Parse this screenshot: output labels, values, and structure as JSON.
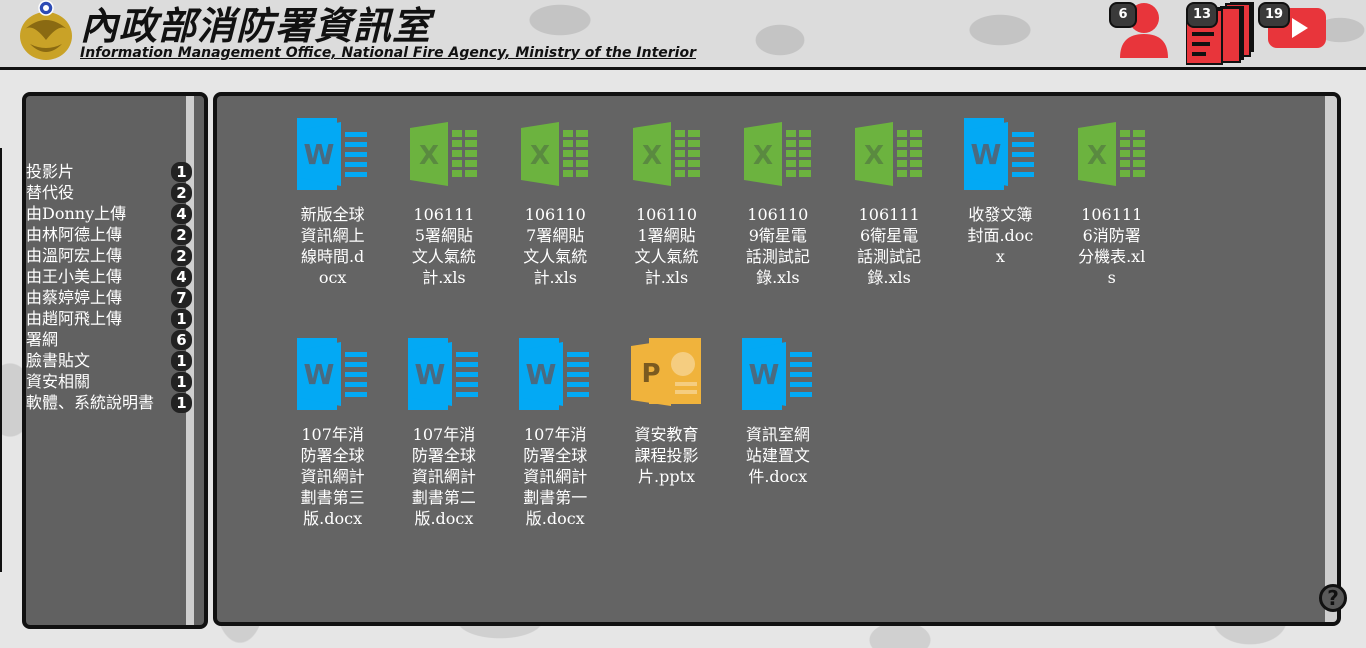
{
  "header": {
    "title_cn": "內政部消防署資訊室",
    "title_en": "Information Management Office, National Fire Agency, Ministry of the Interior",
    "users_count": "6",
    "documents_count": "13",
    "videos_count": "19",
    "icons": {
      "users": "person-icon",
      "documents": "document-stack-icon",
      "videos": "youtube-play-icon",
      "logo": "agency-emblem-logo"
    }
  },
  "sidebar": {
    "categories": [
      {
        "label": "投影片",
        "count": "1"
      },
      {
        "label": "替代役",
        "count": "2"
      },
      {
        "label": "由Donny上傳",
        "count": "4"
      },
      {
        "label": "由林阿德上傳",
        "count": "2"
      },
      {
        "label": "由溫阿宏上傳",
        "count": "2"
      },
      {
        "label": "由王小美上傳",
        "count": "4"
      },
      {
        "label": "由蔡婷婷上傳",
        "count": "7"
      },
      {
        "label": "由趙阿飛上傳",
        "count": "1"
      },
      {
        "label": "署網",
        "count": "6"
      },
      {
        "label": "臉書貼文",
        "count": "1"
      },
      {
        "label": "資安相關",
        "count": "1"
      },
      {
        "label": "軟體、系統說明書",
        "count": "1"
      }
    ]
  },
  "files": [
    {
      "name": "新版全球資訊網上線時間.docx",
      "type": "word"
    },
    {
      "name": "1061115署網貼文人氣統計.xls",
      "type": "excel"
    },
    {
      "name": "1061107署網貼文人氣統計.xls",
      "type": "excel"
    },
    {
      "name": "1061101署網貼文人氣統計.xls",
      "type": "excel"
    },
    {
      "name": "1061109衛星電話測試記錄.xls",
      "type": "excel"
    },
    {
      "name": "1061116衛星電話測試記錄.xls",
      "type": "excel"
    },
    {
      "name": "收發文簿封面.docx",
      "type": "word"
    },
    {
      "name": "1061116消防署分機表.xls",
      "type": "excel"
    },
    {
      "name": "107年消防署全球資訊網計劃書第三版.docx",
      "type": "word"
    },
    {
      "name": "107年消防署全球資訊網計劃書第二版.docx",
      "type": "word"
    },
    {
      "name": "107年消防署全球資訊網計劃書第一版.docx",
      "type": "word"
    },
    {
      "name": "資安教育課程投影片.pptx",
      "type": "powerpoint"
    },
    {
      "name": "資訊室網站建置文件.docx",
      "type": "word"
    }
  ],
  "help": {
    "label": "?",
    "icon": "help-icon"
  },
  "colors": {
    "word": "#03a9f4",
    "excel": "#6cb33f",
    "powerpoint": "#f0b33c",
    "accent_red": "#e8353b"
  }
}
